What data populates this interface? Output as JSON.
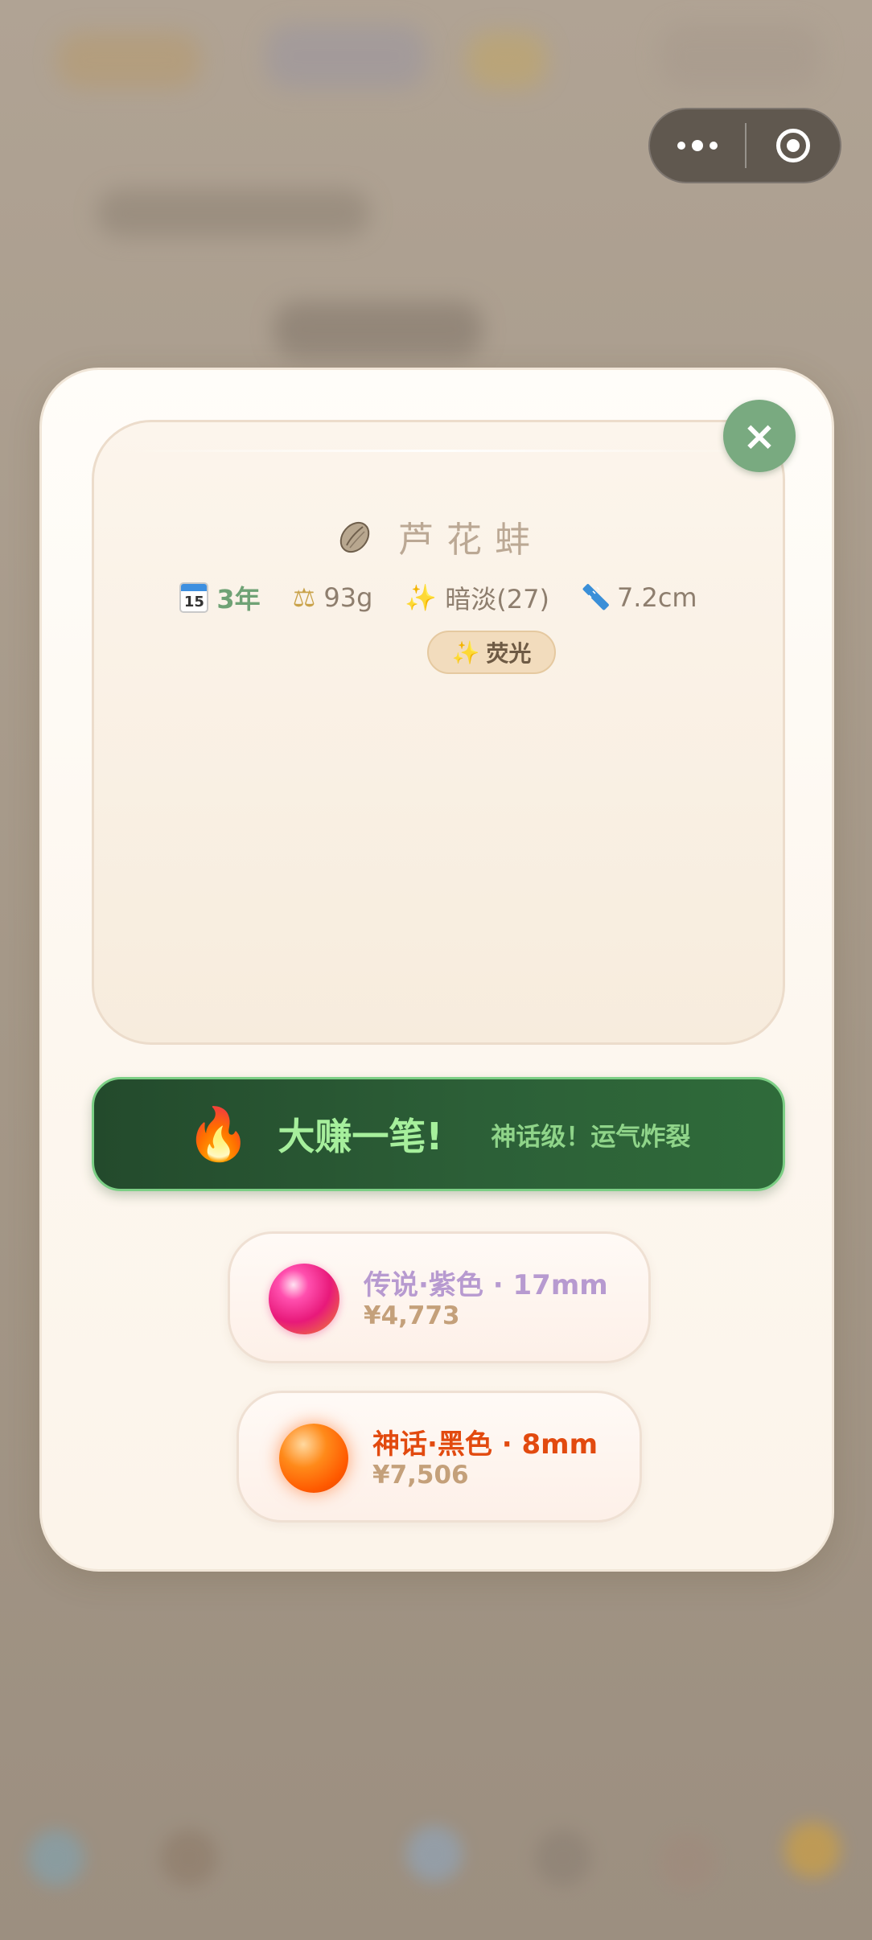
{
  "capsule": {
    "more_icon": "more-dots-icon",
    "close_icon": "target-close-icon"
  },
  "modal": {
    "close_label": "×",
    "shell": {
      "icon": "oyster-icon",
      "name": "芦花蚌",
      "stats": {
        "age": "3年",
        "weight": "93g",
        "luster": "暗淡(27)",
        "size": "7.2cm"
      },
      "tag": "荧光",
      "tag_icon": "sparkles-icon"
    },
    "banner": {
      "icon": "fire-icon",
      "title": "大赚一笔!",
      "subtitle": "神话级！运气炸裂"
    },
    "pearls": [
      {
        "title": "传说·紫色 · 17mm",
        "price": "¥4,773",
        "color": "#b79ad0",
        "pearl_color": "#e8197a"
      },
      {
        "title": "神话·黑色 · 8mm",
        "price": "¥7,506",
        "color": "#e24a0f",
        "pearl_color": "#ff6a00"
      }
    ]
  }
}
